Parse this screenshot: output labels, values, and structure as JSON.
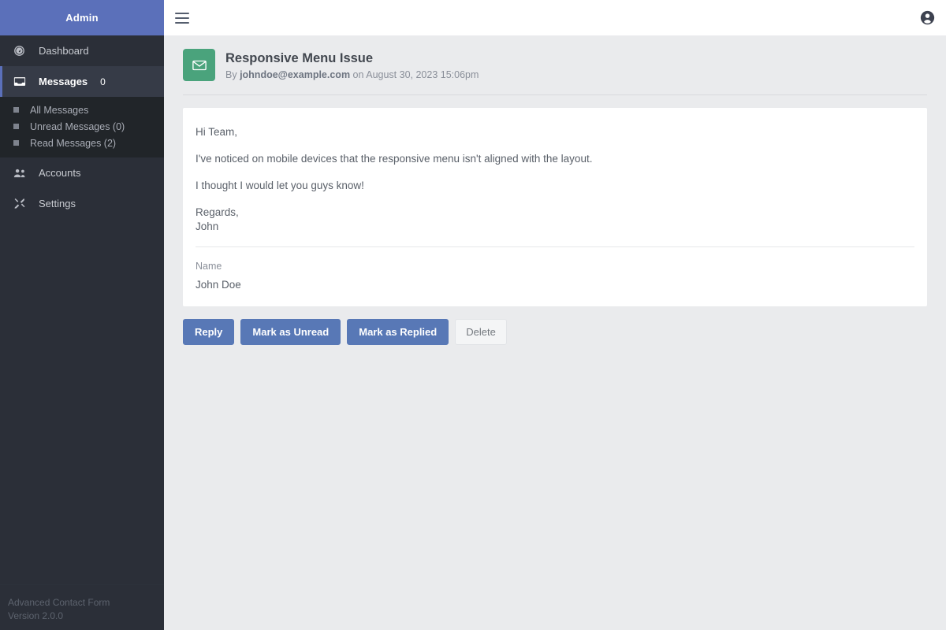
{
  "sidebar": {
    "brand": "Admin",
    "items": [
      {
        "label": "Dashboard",
        "icon": "gauge-icon",
        "badge": ""
      },
      {
        "label": "Messages",
        "icon": "inbox-icon",
        "badge": "0"
      },
      {
        "label": "Accounts",
        "icon": "users-icon",
        "badge": ""
      },
      {
        "label": "Settings",
        "icon": "tools-icon",
        "badge": ""
      }
    ],
    "submenu": [
      {
        "label": "All Messages"
      },
      {
        "label": "Unread Messages (0)"
      },
      {
        "label": "Read Messages (2)"
      }
    ],
    "footer": {
      "app_name": "Advanced Contact Form",
      "version": "Version 2.0.0"
    },
    "colors": {
      "brand_bg": "#5b70ba",
      "bg": "#2b2f38",
      "submenu_bg": "#212529",
      "active_bg": "#363b47"
    }
  },
  "topbar": {
    "menu_toggle_icon": "hamburger-icon",
    "account_icon": "account-circle-icon"
  },
  "message": {
    "icon": "envelope-icon",
    "icon_bg": "#4aa37c",
    "title": "Responsive Menu Issue",
    "byline_prefix": "By ",
    "sender_email": "johndoe@example.com",
    "byline_middle": " on ",
    "timestamp": "August 30, 2023 15:06pm",
    "body": [
      "Hi Team,",
      "I've noticed on mobile devices that the responsive menu isn't aligned with the layout.",
      "I thought I would let you guys know!"
    ],
    "signoff": "Regards,\nJohn",
    "field_label": "Name",
    "field_value": "John Doe"
  },
  "actions": [
    {
      "label": "Reply",
      "style": "primary"
    },
    {
      "label": "Mark as Unread",
      "style": "primary"
    },
    {
      "label": "Mark as Replied",
      "style": "primary"
    },
    {
      "label": "Delete",
      "style": "light"
    }
  ]
}
